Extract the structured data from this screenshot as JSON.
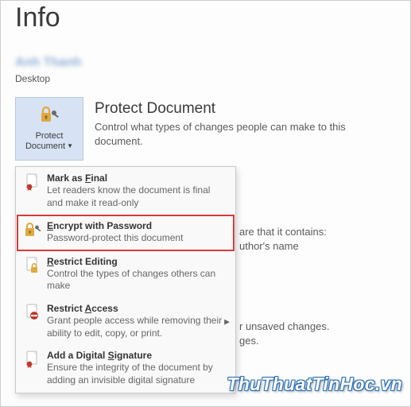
{
  "page": {
    "title": "Info"
  },
  "document": {
    "title": "Anh Thanh",
    "location": "Desktop"
  },
  "protect": {
    "tile_line1": "Protect",
    "tile_line2": "Document",
    "heading": "Protect Document",
    "description": "Control what types of changes people can make to this document."
  },
  "menu": {
    "items": [
      {
        "title_pre": "Mark as ",
        "title_u": "F",
        "title_post": "inal",
        "desc": "Let readers know the document is final and make it read-only",
        "icon": "document-seal-icon",
        "highlight": false,
        "submenu": false
      },
      {
        "title_pre": "",
        "title_u": "E",
        "title_post": "ncrypt with Password",
        "desc": "Password-protect this document",
        "icon": "lock-key-icon",
        "highlight": true,
        "submenu": false
      },
      {
        "title_pre": "",
        "title_u": "R",
        "title_post": "estrict Editing",
        "desc": "Control the types of changes others can make",
        "icon": "document-lock-icon",
        "highlight": false,
        "submenu": false
      },
      {
        "title_pre": "Restrict ",
        "title_u": "A",
        "title_post": "ccess",
        "desc": "Grant people access while removing their ability to edit, copy, or print.",
        "icon": "document-restrict-icon",
        "highlight": false,
        "submenu": true
      },
      {
        "title_pre": "Add a Digital ",
        "title_u": "S",
        "title_post": "ignature",
        "desc": "Ensure the integrity of the document by adding an invisible digital signature",
        "icon": "document-signature-icon",
        "highlight": false,
        "submenu": false
      }
    ]
  },
  "background_snippets": {
    "a1": "are that it contains:",
    "a2": "uthor's name",
    "b1": "r unsaved changes.",
    "b2": "ges."
  },
  "colors": {
    "accent": "#d7e3f4",
    "highlight_border": "#d83a3a",
    "lock_gold": "#e0a93e"
  },
  "watermark": "ThuThuatTinHoc.vn"
}
